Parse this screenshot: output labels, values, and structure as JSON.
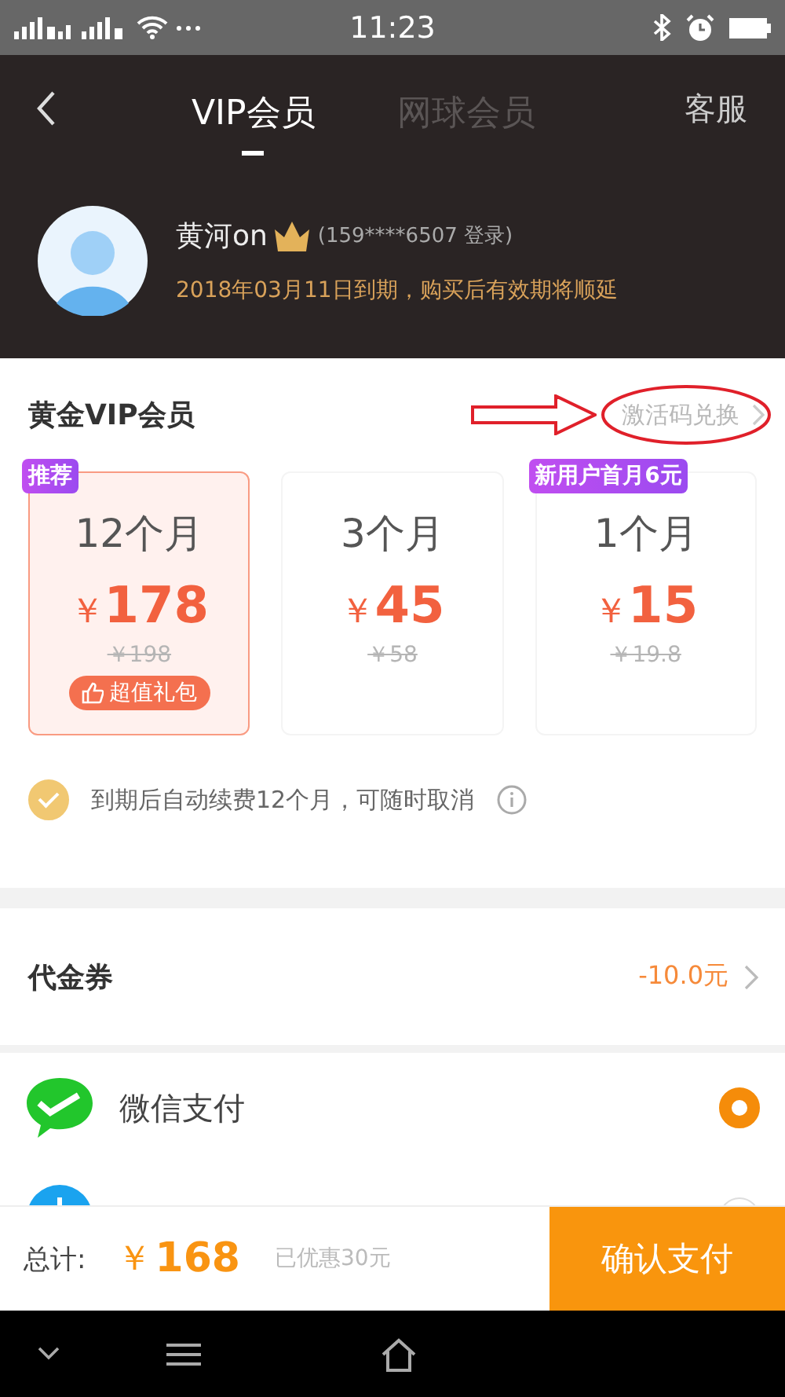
{
  "status_bar": {
    "time": "11:23"
  },
  "header": {
    "tabs": [
      {
        "label": "VIP会员",
        "selected": true
      },
      {
        "label": "网球会员",
        "selected": false
      }
    ],
    "service": "客服"
  },
  "user": {
    "name": "黄河on",
    "phone": "(159****6507 登录)",
    "expiry": "2018年03月11日到期，购买后有效期将顺延"
  },
  "membership": {
    "title": "黄金VIP会员",
    "redeem": "激活码兑换",
    "plans": [
      {
        "duration": "12个月",
        "currency": "￥",
        "price": "178",
        "original": "￥198",
        "badge": "推荐",
        "gift": "超值礼包",
        "selected": true
      },
      {
        "duration": "3个月",
        "currency": "￥",
        "price": "45",
        "original": "￥58",
        "selected": false
      },
      {
        "duration": "1个月",
        "currency": "￥",
        "price": "15",
        "original": "￥19.8",
        "badge": "新用户首月6元",
        "selected": false
      }
    ],
    "auto_renew": {
      "label": "到期后自动续费12个月，可随时取消",
      "checked": true
    }
  },
  "voucher": {
    "label": "代金券",
    "value": "-10.0元"
  },
  "payments": [
    {
      "kind": "wechat",
      "label": "微信支付",
      "selected": true
    },
    {
      "kind": "alipay",
      "selected": false
    }
  ],
  "footer": {
    "total_label": "总计:",
    "currency": "￥",
    "total": "168",
    "discount": "已优惠30元",
    "confirm": "确认支付"
  }
}
